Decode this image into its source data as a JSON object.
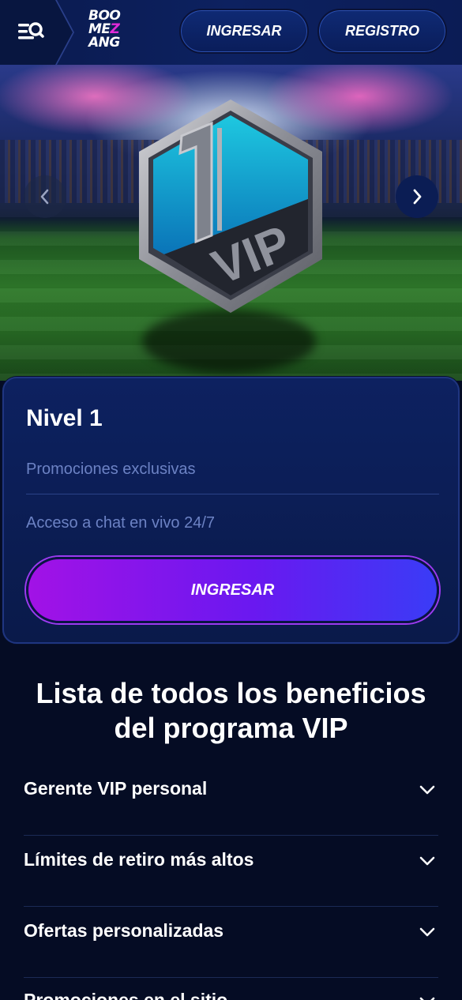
{
  "header": {
    "logo_lines": [
      "BOO",
      "ME",
      "Z",
      "ANG"
    ],
    "login_label": "INGRESAR",
    "register_label": "REGISTRO"
  },
  "hero": {
    "badge_text": "VIP",
    "badge_number": "1"
  },
  "level_card": {
    "title": "Nivel 1",
    "benefits": [
      "Promociones exclusivas",
      "Acceso a chat en vivo 24/7"
    ],
    "cta_label": "INGRESAR"
  },
  "benefits_section": {
    "heading_line1": "Lista de todos los beneficios",
    "heading_line2": "del programa VIP",
    "items": [
      {
        "label": "Gerente VIP personal"
      },
      {
        "label": "Límites de retiro más altos"
      },
      {
        "label": "Ofertas personalizadas"
      },
      {
        "label": "Promociones en el sitio"
      }
    ]
  },
  "colors": {
    "background": "#050c24",
    "header": "#0d2160",
    "card": "#0d2160",
    "cta_gradient_start": "#a212e6",
    "cta_gradient_end": "#3a3cf6",
    "muted_text": "#6c82c4",
    "logo_accent": "#e12ad8"
  },
  "icons": [
    "menu-search-icon",
    "chevron-left-icon",
    "chevron-right-icon",
    "chevron-down-icon"
  ]
}
